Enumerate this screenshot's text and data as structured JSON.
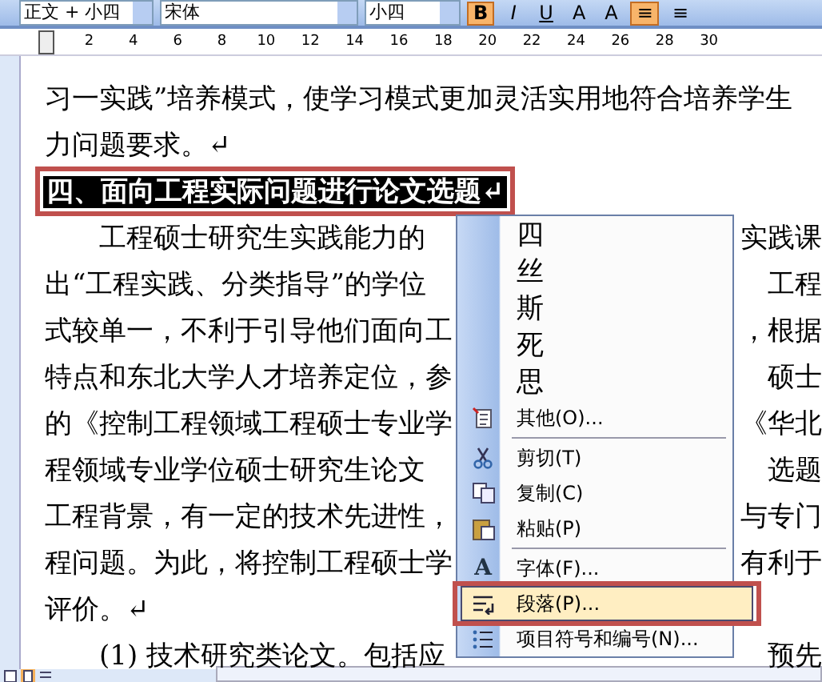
{
  "toolbar": {
    "style": "正文 + 小四",
    "font": "宋体",
    "size": "小四",
    "buttons": [
      {
        "label": "B",
        "kind": "bold",
        "selected": true
      },
      {
        "label": "I",
        "kind": "italic",
        "selected": false
      },
      {
        "label": "U",
        "kind": "underline",
        "selected": false
      },
      {
        "label": "A",
        "kind": "border",
        "selected": false
      },
      {
        "label": "A",
        "kind": "shade",
        "selected": false
      },
      {
        "label": "≡",
        "kind": "align",
        "selected": true
      },
      {
        "label": "≡",
        "kind": "align",
        "selected": false
      }
    ]
  },
  "ruler": {
    "labels": [
      "2",
      "4",
      "6",
      "8",
      "10",
      "12",
      "14",
      "16",
      "18",
      "20",
      "22",
      "24",
      "26",
      "28",
      "30"
    ]
  },
  "document": {
    "lines": [
      {
        "kind": "body",
        "text": "习一实践”培养模式，使学习模式更加灵活实用地符合培养学生"
      },
      {
        "kind": "body",
        "text": "力问题要求。↵"
      },
      {
        "kind": "heading",
        "text": "四、面向工程实际问题进行论文选题↵",
        "marked": true
      },
      {
        "kind": "indent",
        "text": "工程硕士研究生实践能力的",
        "tail": "实践课"
      },
      {
        "kind": "body",
        "text": "出“工程实践、分类指导”的学位",
        "tail": "工程"
      },
      {
        "kind": "body",
        "text": "式较单一，不利于引导他们面向工",
        "tail": "，根据"
      },
      {
        "kind": "body",
        "text": "特点和东北大学人才培养定位，参",
        "tail": "硕士"
      },
      {
        "kind": "body",
        "text": "的《控制工程领域工程硕士专业学",
        "tail": "《华北"
      },
      {
        "kind": "body",
        "text": "程领域专业学位硕士研究生论文",
        "tail": "选题"
      },
      {
        "kind": "body",
        "text": "工程背景，有一定的技术先进性，",
        "tail": "与专门"
      },
      {
        "kind": "body",
        "text": "程问题。为此，将控制工程硕士学",
        "tail": "有利于"
      },
      {
        "kind": "body",
        "text": "评价。↵"
      },
      {
        "kind": "indent",
        "text": "(1) 技术研究类论文。包括应",
        "tail": "预先"
      }
    ]
  },
  "context_menu": {
    "items": [
      {
        "kind": "char",
        "label": "四"
      },
      {
        "kind": "char",
        "label": "丝"
      },
      {
        "kind": "char",
        "label": "斯"
      },
      {
        "kind": "char",
        "label": "死"
      },
      {
        "kind": "char",
        "label": "思"
      },
      {
        "kind": "command",
        "label": "其他(O)...",
        "selected": false
      },
      {
        "kind": "separator"
      },
      {
        "kind": "command",
        "label": "剪切(T)",
        "selected": false
      },
      {
        "kind": "command",
        "label": "复制(C)",
        "selected": false
      },
      {
        "kind": "command",
        "label": "粘贴(P)",
        "selected": false
      },
      {
        "kind": "separator"
      },
      {
        "kind": "command",
        "label": "字体(F)...",
        "icon_glyph": "A",
        "selected": false
      },
      {
        "kind": "command",
        "label": "段落(P)...",
        "selected": true,
        "marked": true
      },
      {
        "kind": "command",
        "label": "项目符号和编号(N)...",
        "selected": false
      }
    ]
  }
}
